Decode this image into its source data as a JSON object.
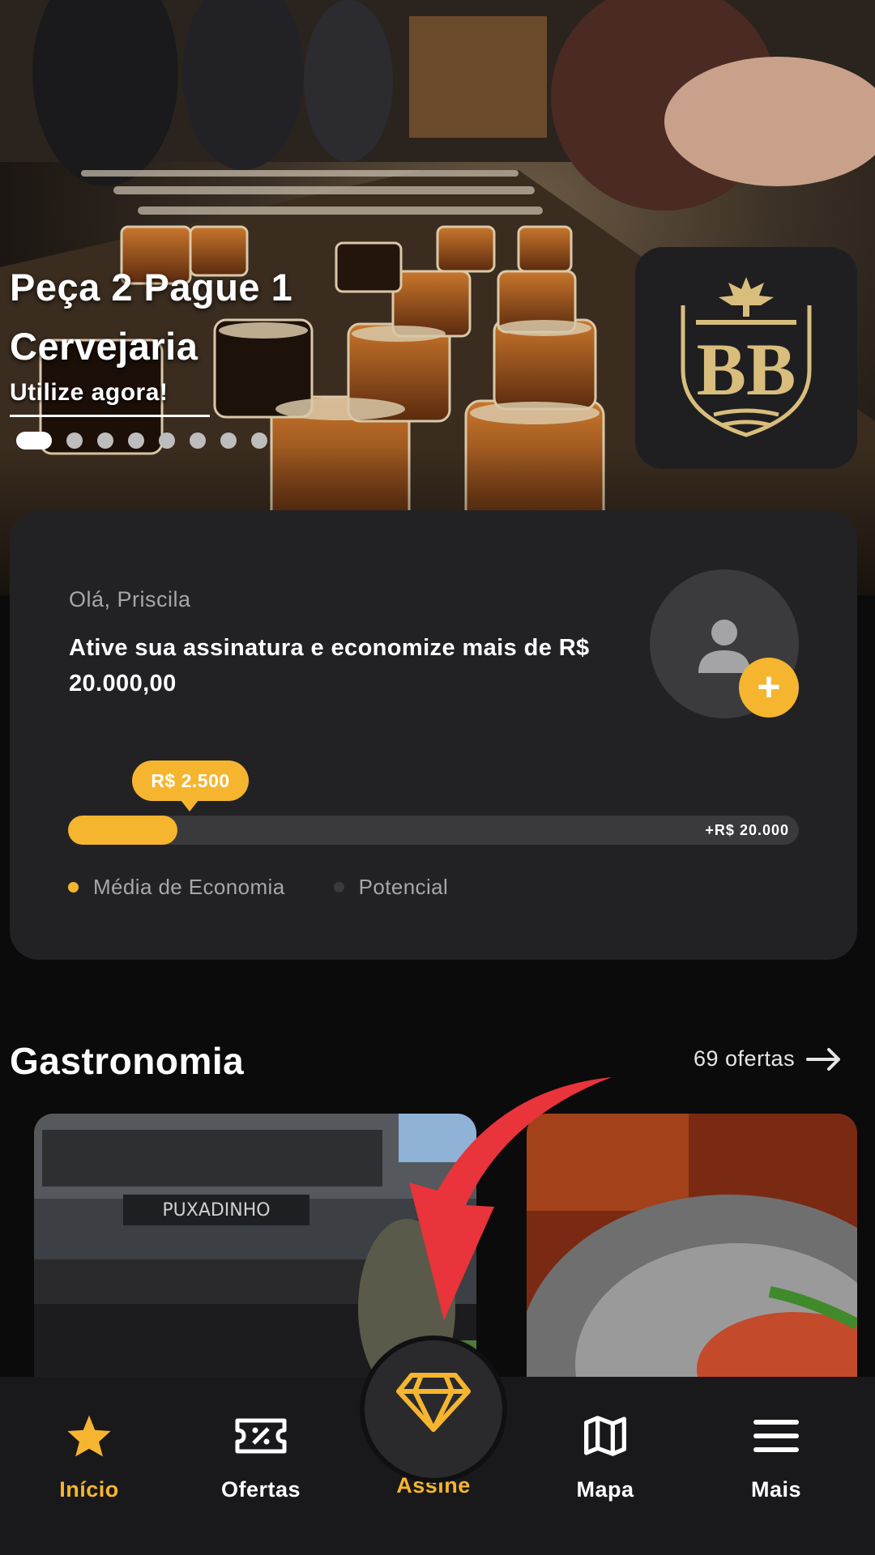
{
  "hero": {
    "title_line1": "Peça 2 Pague 1",
    "title_line2": "Cervejaria",
    "cta": "Utilize agora!",
    "carousel_total": 8,
    "carousel_active": 1
  },
  "subscription_card": {
    "greeting": "Olá, Priscila",
    "headline": "Ative sua assinatura e economize mais de  R$ 20.000,00",
    "progress_tooltip": "R$ 2.500",
    "progress_max_label": "+R$ 20.000",
    "progress_fraction": 0.125,
    "legend": [
      {
        "label": "Média de Economia",
        "color": "#f6b52f"
      },
      {
        "label": "Potencial",
        "color": "#3a3a3c"
      }
    ]
  },
  "section": {
    "title": "Gastronomia",
    "link": "69 ofertas"
  },
  "nav": {
    "items": [
      {
        "label": "Início",
        "icon": "star-icon",
        "active": true
      },
      {
        "label": "Ofertas",
        "icon": "ticket-icon",
        "active": false
      },
      {
        "label": "Assine",
        "icon": "diamond-icon",
        "active": true
      },
      {
        "label": "Mapa",
        "icon": "map-icon",
        "active": false
      },
      {
        "label": "Mais",
        "icon": "menu-icon",
        "active": false
      }
    ]
  },
  "colors": {
    "accent": "#f6b52f",
    "background": "#0b0b0c",
    "card": "#222224",
    "annotation_arrow": "#e8343a"
  }
}
